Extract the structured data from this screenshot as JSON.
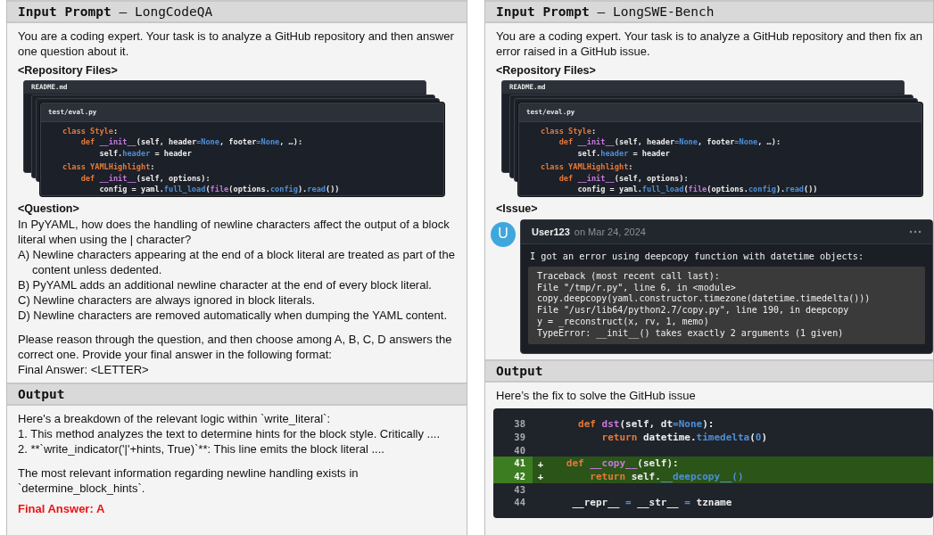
{
  "panels": [
    {
      "sections": [
        {
          "header": "**Input Prompt** – LongCodeQA",
          "blocks": [
            {
              "kind": "text",
              "lines": [
                "You are a coding expert. Your task is to analyze a GitHub repository and then answer one question about it."
              ]
            },
            {
              "kind": "heading",
              "text": "<Repository Files>"
            },
            {
              "kind": "files",
              "back_tab": "README.md",
              "tab": "test/eval.py",
              "lines": [
                [
                  {
                    "t": "class ",
                    "kind": "kw"
                  },
                  {
                    "t": "Style",
                    "kind": "kw"
                  },
                  {
                    "t": ":",
                    "kind": "plain"
                  }
                ],
                [
                  {
                    "t": "    def ",
                    "kind": "kw"
                  },
                  {
                    "t": "__init__",
                    "kind": "fn"
                  },
                  {
                    "t": "(self, header",
                    "kind": "plain"
                  },
                  {
                    "t": "=None",
                    "kind": "attr"
                  },
                  {
                    "t": ", footer",
                    "kind": "plain"
                  },
                  {
                    "t": "=None",
                    "kind": "attr"
                  },
                  {
                    "t": ", …):",
                    "kind": "plain"
                  }
                ],
                [
                  {
                    "t": "        self.",
                    "kind": "plain"
                  },
                  {
                    "t": "header",
                    "kind": "attr"
                  },
                  {
                    "t": " = header",
                    "kind": "plain"
                  }
                ],
                [
                  {
                    "t": "class ",
                    "kind": "kw"
                  },
                  {
                    "t": "YAMLHighlight",
                    "kind": "kw"
                  },
                  {
                    "t": ":",
                    "kind": "plain"
                  }
                ],
                [
                  {
                    "t": "    def ",
                    "kind": "kw"
                  },
                  {
                    "t": "__init__",
                    "kind": "fn"
                  },
                  {
                    "t": "(self, options):",
                    "kind": "plain"
                  }
                ],
                [
                  {
                    "t": "        config = yaml.",
                    "kind": "plain"
                  },
                  {
                    "t": "full_load",
                    "kind": "attr"
                  },
                  {
                    "t": "(",
                    "kind": "plain"
                  },
                  {
                    "t": "file",
                    "kind": "fn"
                  },
                  {
                    "t": "(options.",
                    "kind": "plain"
                  },
                  {
                    "t": "config",
                    "kind": "attr"
                  },
                  {
                    "t": ").",
                    "kind": "plain"
                  },
                  {
                    "t": "read",
                    "kind": "attr"
                  },
                  {
                    "t": "())",
                    "kind": "plain"
                  }
                ]
              ]
            },
            {
              "kind": "heading",
              "text": "<Question>"
            },
            {
              "kind": "text",
              "lines": [
                "In PyYAML, how does the handling of newline characters affect the output of a block literal when using the | character?"
              ]
            },
            {
              "kind": "options",
              "items": [
                "A) Newline characters appearing at the end of a block literal are treated as part of the content unless dedented.",
                "B) PyYAML adds an additional newline character at the end of every block literal.",
                "C) Newline characters are always ignored in block literals.",
                "D) Newline characters are removed automatically when dumping the YAML content."
              ]
            },
            {
              "kind": "text",
              "lines": [
                "Please reason through the question, and then choose among A, B, C, D answers the correct one. Provide your final answer in the following format:",
                "Final Answer: <LETTER>"
              ]
            }
          ]
        },
        {
          "header": "**Output**",
          "blocks": [
            {
              "kind": "text",
              "lines": [
                "Here's a breakdown of the relevant logic within `write_literal`:",
                "1. This method analyzes the text to determine hints for the block style. Critically ....",
                "2. **`write_indicator('|'+hints, True)`**: This line emits the block literal ...."
              ]
            },
            {
              "kind": "text",
              "lines": [
                "The most relevant information regarding newline handling exists in `determine_block_hints`."
              ]
            },
            {
              "kind": "final",
              "text": "Final Answer: A"
            }
          ]
        }
      ]
    },
    {
      "sections": [
        {
          "header": "**Input Prompt** – LongSWE-Bench",
          "blocks": [
            {
              "kind": "text",
              "lines": [
                "You are a coding expert. Your task is to analyze a GitHub repository and then fix an error raised in a GitHub issue."
              ]
            },
            {
              "kind": "heading",
              "text": "<Repository Files>"
            },
            {
              "kind": "files",
              "back_tab": "README.md",
              "tab": "test/eval.py",
              "lines": [
                [
                  {
                    "t": "class ",
                    "kind": "kw"
                  },
                  {
                    "t": "Style",
                    "kind": "kw"
                  },
                  {
                    "t": ":",
                    "kind": "plain"
                  }
                ],
                [
                  {
                    "t": "    def ",
                    "kind": "kw"
                  },
                  {
                    "t": "__init__",
                    "kind": "fn"
                  },
                  {
                    "t": "(self, header",
                    "kind": "plain"
                  },
                  {
                    "t": "=None",
                    "kind": "attr"
                  },
                  {
                    "t": ", footer",
                    "kind": "plain"
                  },
                  {
                    "t": "=None",
                    "kind": "attr"
                  },
                  {
                    "t": ", …):",
                    "kind": "plain"
                  }
                ],
                [
                  {
                    "t": "        self.",
                    "kind": "plain"
                  },
                  {
                    "t": "header",
                    "kind": "attr"
                  },
                  {
                    "t": " = header",
                    "kind": "plain"
                  }
                ],
                [
                  {
                    "t": "class ",
                    "kind": "kw"
                  },
                  {
                    "t": "YAMLHighlight",
                    "kind": "kw"
                  },
                  {
                    "t": ":",
                    "kind": "plain"
                  }
                ],
                [
                  {
                    "t": "    def ",
                    "kind": "kw"
                  },
                  {
                    "t": "__init__",
                    "kind": "fn"
                  },
                  {
                    "t": "(self, options):",
                    "kind": "plain"
                  }
                ],
                [
                  {
                    "t": "        config = yaml.",
                    "kind": "plain"
                  },
                  {
                    "t": "full_load",
                    "kind": "attr"
                  },
                  {
                    "t": "(",
                    "kind": "plain"
                  },
                  {
                    "t": "file",
                    "kind": "fn"
                  },
                  {
                    "t": "(options.",
                    "kind": "plain"
                  },
                  {
                    "t": "config",
                    "kind": "attr"
                  },
                  {
                    "t": ").",
                    "kind": "plain"
                  },
                  {
                    "t": "read",
                    "kind": "attr"
                  },
                  {
                    "t": "())",
                    "kind": "plain"
                  }
                ]
              ]
            },
            {
              "kind": "heading",
              "text": "<Issue>"
            },
            {
              "kind": "issue",
              "avatar": "U",
              "user": "User123",
              "date": "on Mar 24, 2024",
              "message": "I got an error using deepcopy function with datetime objects:",
              "traceback": [
                "Traceback (most recent call last):",
                "File \"/tmp/r.py\", line 6, in <module>",
                "copy.deepcopy(yaml.constructor.timezone(datetime.timedelta()))",
                "File \"/usr/lib64/python2.7/copy.py\", line 190, in deepcopy",
                "y = _reconstruct(x, rv, 1, memo)",
                "TypeError: __init__() takes exactly 2 arguments (1 given)"
              ]
            }
          ]
        },
        {
          "header": "**Output**",
          "blocks": [
            {
              "kind": "text",
              "lines": [
                "Here’s the fix to solve the GitHub issue"
              ]
            },
            {
              "kind": "diff",
              "rows": [
                {
                  "number": "38",
                  "added": false,
                  "tokens": [
                    {
                      "t": "     def ",
                      "kind": "kw"
                    },
                    {
                      "t": "dst",
                      "kind": "fn"
                    },
                    {
                      "t": "(self, dt",
                      "kind": "plain"
                    },
                    {
                      "t": "=None",
                      "kind": "attr"
                    },
                    {
                      "t": "):",
                      "kind": "plain"
                    }
                  ]
                },
                {
                  "number": "39",
                  "added": false,
                  "tokens": [
                    {
                      "t": "         return ",
                      "kind": "kw"
                    },
                    {
                      "t": "datetime.",
                      "kind": "plain"
                    },
                    {
                      "t": "timedelta",
                      "kind": "attr"
                    },
                    {
                      "t": "(",
                      "kind": "plain"
                    },
                    {
                      "t": "0",
                      "kind": "attr"
                    },
                    {
                      "t": ")",
                      "kind": "plain"
                    }
                  ]
                },
                {
                  "number": "40",
                  "added": false
                },
                {
                  "number": "41",
                  "added": true,
                  "sign": "+",
                  "tokens": [
                    {
                      "t": "   def ",
                      "kind": "kw"
                    },
                    {
                      "t": "__copy__",
                      "kind": "fn"
                    },
                    {
                      "t": "(self):",
                      "kind": "plain"
                    }
                  ]
                },
                {
                  "number": "42",
                  "added": true,
                  "sign": "+",
                  "tokens": [
                    {
                      "t": "       return ",
                      "kind": "kw"
                    },
                    {
                      "t": "self.",
                      "kind": "plain"
                    },
                    {
                      "t": "__deepcopy__()",
                      "kind": "attr"
                    }
                  ]
                },
                {
                  "number": "43",
                  "added": false
                },
                {
                  "number": "44",
                  "added": false,
                  "tokens": [
                    {
                      "t": "    __repr__ ",
                      "kind": "plain"
                    },
                    {
                      "t": "=",
                      "kind": "attr"
                    },
                    {
                      "t": " __str__ ",
                      "kind": "plain"
                    },
                    {
                      "t": "=",
                      "kind": "attr"
                    },
                    {
                      "t": " tzname",
                      "kind": "plain"
                    }
                  ]
                }
              ]
            }
          ]
        }
      ]
    }
  ]
}
